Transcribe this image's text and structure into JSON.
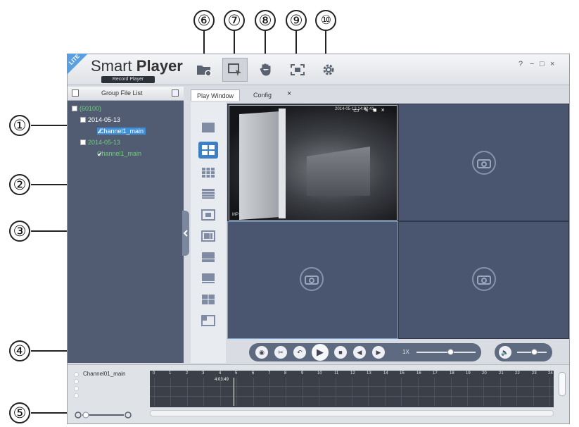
{
  "callouts": [
    "①",
    "②",
    "③",
    "④",
    "⑤",
    "⑥",
    "⑦",
    "⑧",
    "⑨",
    "⑩"
  ],
  "app": {
    "badge": "LITE",
    "brand_light": "Smart ",
    "brand_bold": "Player",
    "subtitle": "Record Player",
    "window_controls": {
      "help": "?",
      "minimize": "−",
      "maximize": "□",
      "close": "×"
    }
  },
  "toolbar": [
    {
      "name": "open-file",
      "icon": "folder-open-icon"
    },
    {
      "name": "playback",
      "icon": "screen-play-icon",
      "active": true
    },
    {
      "name": "hand-tool",
      "icon": "hand-icon"
    },
    {
      "name": "fullscreen",
      "icon": "fullscreen-icon"
    },
    {
      "name": "settings",
      "icon": "gear-icon"
    }
  ],
  "file_list": {
    "title": "Group File List",
    "tree": [
      {
        "label": "(60100)",
        "level": 0
      },
      {
        "label": "2014-05-13",
        "level": 1
      },
      {
        "label": "Channel1_main",
        "level": 2,
        "selected": true
      },
      {
        "label": "2014-05-13",
        "level": 1
      },
      {
        "label": "Channel1_main",
        "level": 2
      }
    ]
  },
  "tabs": [
    {
      "label": "Play Window",
      "active": true
    },
    {
      "label": "Config",
      "active": false
    }
  ],
  "tab_close": "×",
  "live_view": {
    "timestamp": "2014-05-13 14:02:41",
    "channel_tag": "MP1",
    "tools": [
      "▭",
      "✎",
      "■",
      "×"
    ]
  },
  "controls": {
    "speed": "1X",
    "buttons": [
      "snapshot",
      "clip",
      "back",
      "play",
      "stop",
      "prev-frame",
      "next-frame"
    ],
    "glyphs": {
      "snapshot": "◉",
      "clip": "✂",
      "back": "↶",
      "play": "▶",
      "stop": "■",
      "prev": "◀",
      "next": "▶",
      "volume": "🔈"
    }
  },
  "timeline": {
    "channel_label": "Channel01_main",
    "current_time": "4:03:49",
    "hours": [
      "0",
      "1",
      "2",
      "3",
      "4",
      "5",
      "6",
      "7",
      "8",
      "9",
      "10",
      "11",
      "12",
      "13",
      "14",
      "15",
      "16",
      "17",
      "18",
      "19",
      "20",
      "21",
      "22",
      "23",
      "24"
    ],
    "zoom_out": "−",
    "zoom_in": "+"
  },
  "colors": {
    "panel": "#515c72",
    "video_bg": "#4a5670",
    "accent": "#3c7fc5",
    "tree_green": "#6fd07a"
  }
}
